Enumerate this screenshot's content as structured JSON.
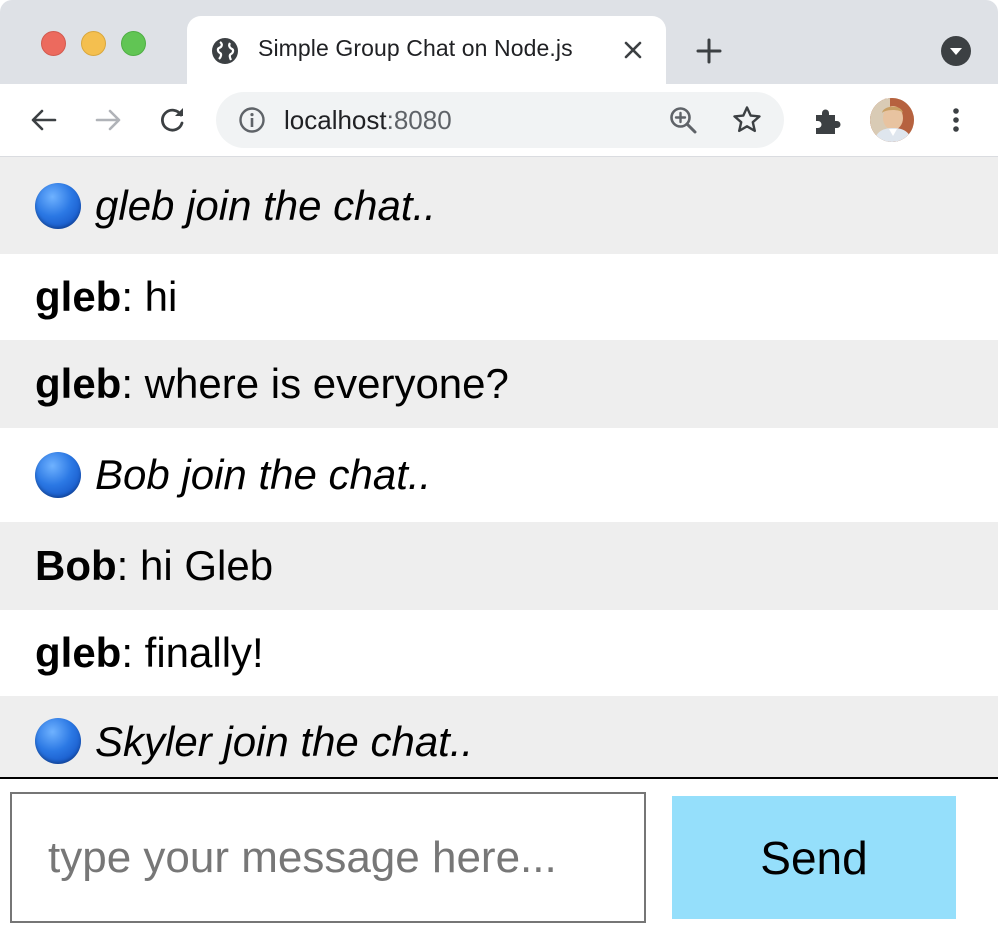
{
  "browser": {
    "tab_title": "Simple Group Chat on Node.js",
    "url_host": "localhost",
    "url_port": ":8080"
  },
  "chat": {
    "messages": [
      {
        "kind": "system",
        "text": "gleb join the chat.."
      },
      {
        "kind": "user",
        "user": "gleb",
        "text": ": hi"
      },
      {
        "kind": "user",
        "user": "gleb",
        "text": ": where is everyone?"
      },
      {
        "kind": "system",
        "text": "Bob join the chat.."
      },
      {
        "kind": "user",
        "user": "Bob",
        "text": ": hi Gleb"
      },
      {
        "kind": "user",
        "user": "gleb",
        "text": ": finally!"
      },
      {
        "kind": "system",
        "text": "Skyler join the chat.."
      }
    ]
  },
  "composer": {
    "placeholder": "type your message here...",
    "send_label": "Send"
  },
  "colors": {
    "send_button": "#95dffb",
    "row_alt": "#eeeeee",
    "join_dot": "#2b78e4"
  }
}
